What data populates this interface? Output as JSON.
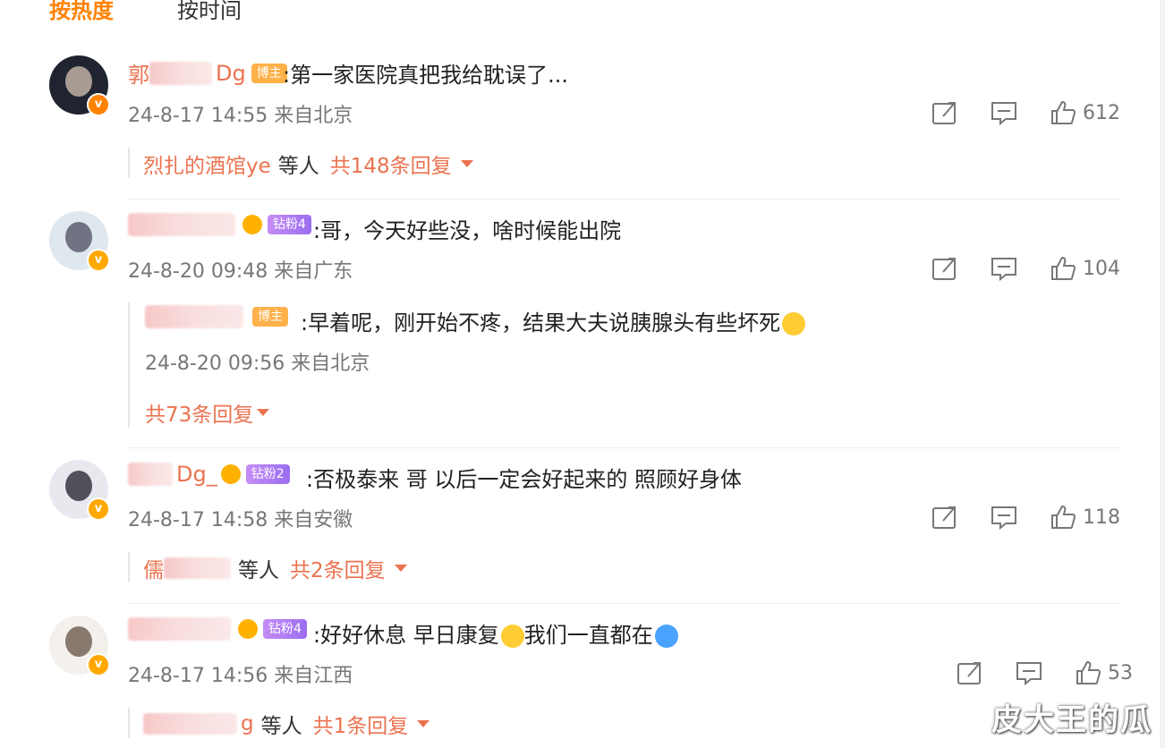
{
  "tabs": {
    "hot": "按热度",
    "time": "按时间"
  },
  "comments": [
    {
      "username_visible": "郭",
      "username_tail": "Dg",
      "badge": "博主",
      "text": ":第一家医院真把我给耽误了...",
      "time": "24-8-17 14:55",
      "location": "来自北京",
      "likes": "612",
      "reply_user": "烈扎的酒馆ye",
      "reply_etc": "等人",
      "reply_count": "共148条回复"
    },
    {
      "badge": "钻粉4",
      "text": ":哥，今天好些没，啥时候能出院",
      "time": "24-8-20 09:48",
      "location": "来自广东",
      "likes": "104",
      "sub_reply": {
        "badge": "博主",
        "text": ":早着呢，刚开始不疼，结果大夫说胰腺头有些坏死",
        "time": "24-8-20 09:56",
        "location": "来自北京"
      },
      "reply_count": "共73条回复"
    },
    {
      "username_tail": "Dg_",
      "badge": "钻粉2",
      "text": ":否极泰来 哥 以后一定会好起来的 照顾好身体",
      "time": "24-8-17 14:58",
      "location": "来自安徽",
      "likes": "118",
      "reply_user": "儒",
      "reply_etc": "等人",
      "reply_count": "共2条回复"
    },
    {
      "badge": "钻粉4",
      "text": ":好好休息 早日康复",
      "text2": "我们一直都在",
      "time": "24-8-17 14:56",
      "location": "来自江西",
      "likes": "53",
      "reply_user_tail": "g",
      "reply_etc": "等人",
      "reply_count": "共1条回复"
    }
  ],
  "watermark": "皮大王的瓜",
  "colors": {
    "accent": "#ff8200",
    "link": "#eb7350"
  }
}
